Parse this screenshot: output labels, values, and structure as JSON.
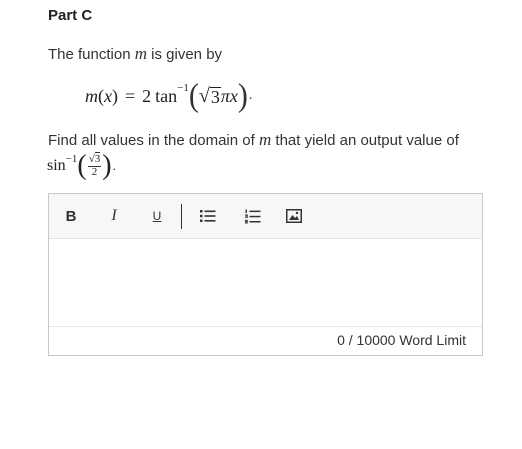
{
  "part": {
    "title": "Part C"
  },
  "intro": {
    "prefix": "The function ",
    "var": "m",
    "suffix": " is given by"
  },
  "equation": {
    "lhs_func": "m",
    "lhs_open": "(",
    "lhs_var": "x",
    "lhs_close": ")",
    "equals": "=",
    "coef": "2",
    "func": "tan",
    "exp": "−1",
    "paren_open": "(",
    "sqrt_sign": "√",
    "radicand": "3",
    "pi": "π",
    "var": "x",
    "paren_close": ")",
    "end": "."
  },
  "question": {
    "prefix": "Find all values in the domain of ",
    "var": "m",
    "suffix": " that yield an output value of",
    "func": "sin",
    "exp": "−1",
    "paren_open": "(",
    "frac_sqrt": "√",
    "frac_radicand": "3",
    "frac_den": "2",
    "paren_close": ")",
    "end": "."
  },
  "editor": {
    "toolbar": {
      "bold": "B",
      "italic": "I",
      "underline": "U"
    },
    "content": "",
    "word_count": "0",
    "word_limit_text": " / 10000 Word Limit"
  }
}
